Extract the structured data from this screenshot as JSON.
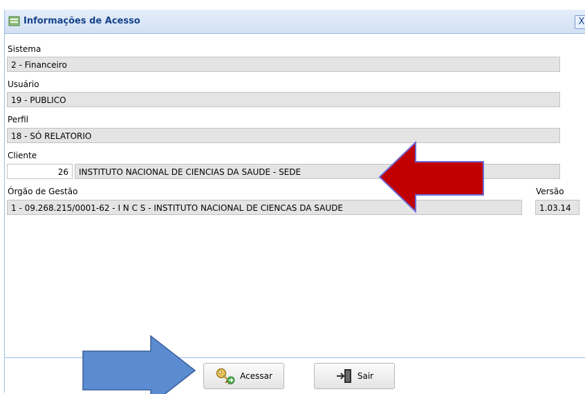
{
  "window": {
    "title": "Informações de Acesso",
    "close_label": "X"
  },
  "fields": {
    "sistema": {
      "label": "Sistema",
      "value": "2 - Financeiro"
    },
    "usuario": {
      "label": "Usuário",
      "value": "19 - PUBLICO"
    },
    "perfil": {
      "label": "Perfil",
      "value": "18 - SÓ RELATORIO"
    },
    "cliente": {
      "label": "Cliente",
      "code": "26",
      "name": "INSTITUTO NACIONAL DE CIENCIAS DA SAUDE - SEDE"
    },
    "orgao": {
      "label": "Órgão de Gestão",
      "value": "1 - 09.268.215/0001-62 - I N C S - INSTITUTO NACIONAL DE CIENCAS DA SAUDE"
    },
    "versao": {
      "label": "Versão",
      "value": "1.03.14"
    }
  },
  "buttons": {
    "acessar": "Acessar",
    "sair": "Sair"
  },
  "annotations": {
    "red_arrow_color": "#c00000",
    "blue_arrow_color": "#5b8bd0"
  }
}
